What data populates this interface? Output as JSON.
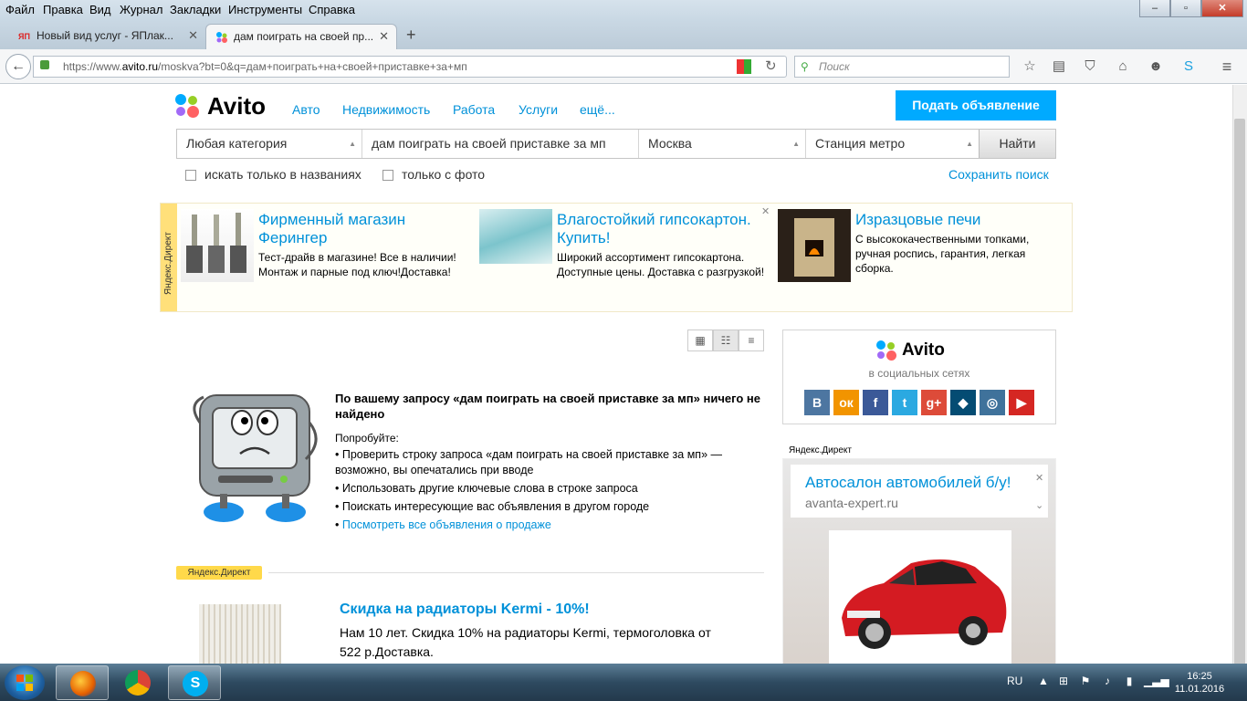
{
  "menu": [
    "Файл",
    "Правка",
    "Вид",
    "Журнал",
    "Закладки",
    "Инструменты",
    "Справка"
  ],
  "tabs": [
    {
      "label": "Новый вид услуг - ЯПлак...",
      "favicon": "ЯП",
      "active": false
    },
    {
      "label": "дам поиграть на своей пр...",
      "active": true
    }
  ],
  "new_tab": "+",
  "url": {
    "prefix": "https://www.",
    "host": "avito.ru",
    "rest": "/moskva?bt=0&q=дам+поиграть+на+своей+приставке+за+мп"
  },
  "browser_search": {
    "placeholder": "Поиск"
  },
  "window_controls": {
    "minimize": "–",
    "maximize": "▫",
    "close": "✕"
  },
  "site": {
    "logo": "Avito",
    "nav": [
      "Авто",
      "Недвижимость",
      "Работа",
      "Услуги",
      "ещё..."
    ],
    "post_button": "Подать объявление",
    "search": {
      "category": "Любая категория",
      "query": "дам поиграть на своей приставке за мп",
      "city": "Москва",
      "metro": "Станция метро",
      "button": "Найти"
    },
    "filters": [
      "искать только в названиях",
      "только с фото"
    ],
    "save_search": "Сохранить поиск"
  },
  "direct_banner": {
    "label": "Яндекс.Директ",
    "close": "✕",
    "ads": [
      {
        "title": "Фирменный магазин Ферингер",
        "text": "Тест-драйв в магазине! Все в наличии! Монтаж и парные под ключ!Доставка!"
      },
      {
        "title": "Влагостойкий гипсокартон. Купить!",
        "text": "Широкий ассортимент гипсокартона. Доступные цены. Доставка с разгрузкой!"
      },
      {
        "title": "Изразцовые печи",
        "text": "С высококачественными топками, ручная роспись, гарантия, легкая сборка."
      }
    ]
  },
  "not_found": {
    "title": "По вашему запросу «дам поиграть на своей приставке за мп» ничего не найдено",
    "try_label": "Попробуйте:",
    "suggestions": [
      "Проверить строку запроса «дам поиграть на своей приставке за мп» — возможно, вы опечатались при вводе",
      "Использовать другие ключевые слова в строке запроса",
      "Поискать интересующие вас объявления в другом городе"
    ],
    "all_ads_link": "Посмотреть все объявления о продаже"
  },
  "direct_inline": {
    "label": "Яндекс.Директ",
    "title": "Скидка на радиаторы Kermi - 10%!",
    "text": "Нам 10 лет. Скидка 10% на радиаторы Kermi, термоголовка от 522 р.Доставка."
  },
  "social": {
    "logo": "Avito",
    "subtitle": "в социальных сетях",
    "networks": [
      {
        "name": "vk",
        "glyph": "В",
        "color": "#4d76a1"
      },
      {
        "name": "odnoklassniki",
        "glyph": "ок",
        "color": "#f29400"
      },
      {
        "name": "facebook",
        "glyph": "f",
        "color": "#3b5998"
      },
      {
        "name": "twitter",
        "glyph": "t",
        "color": "#2ba9e1"
      },
      {
        "name": "google-plus",
        "glyph": "g+",
        "color": "#dd4b39"
      },
      {
        "name": "livejournal",
        "glyph": "◆",
        "color": "#044c73"
      },
      {
        "name": "instagram",
        "glyph": "◎",
        "color": "#3f729b"
      },
      {
        "name": "youtube",
        "glyph": "▶",
        "color": "#d52723"
      }
    ]
  },
  "direct_side": {
    "label": "Яндекс.Директ",
    "title": "Автосалон автомобилей б/у!",
    "domain": "avanta-expert.ru",
    "close": "✕"
  },
  "taskbar": {
    "lang": "RU",
    "time": "16:25",
    "date": "11.01.2016"
  }
}
